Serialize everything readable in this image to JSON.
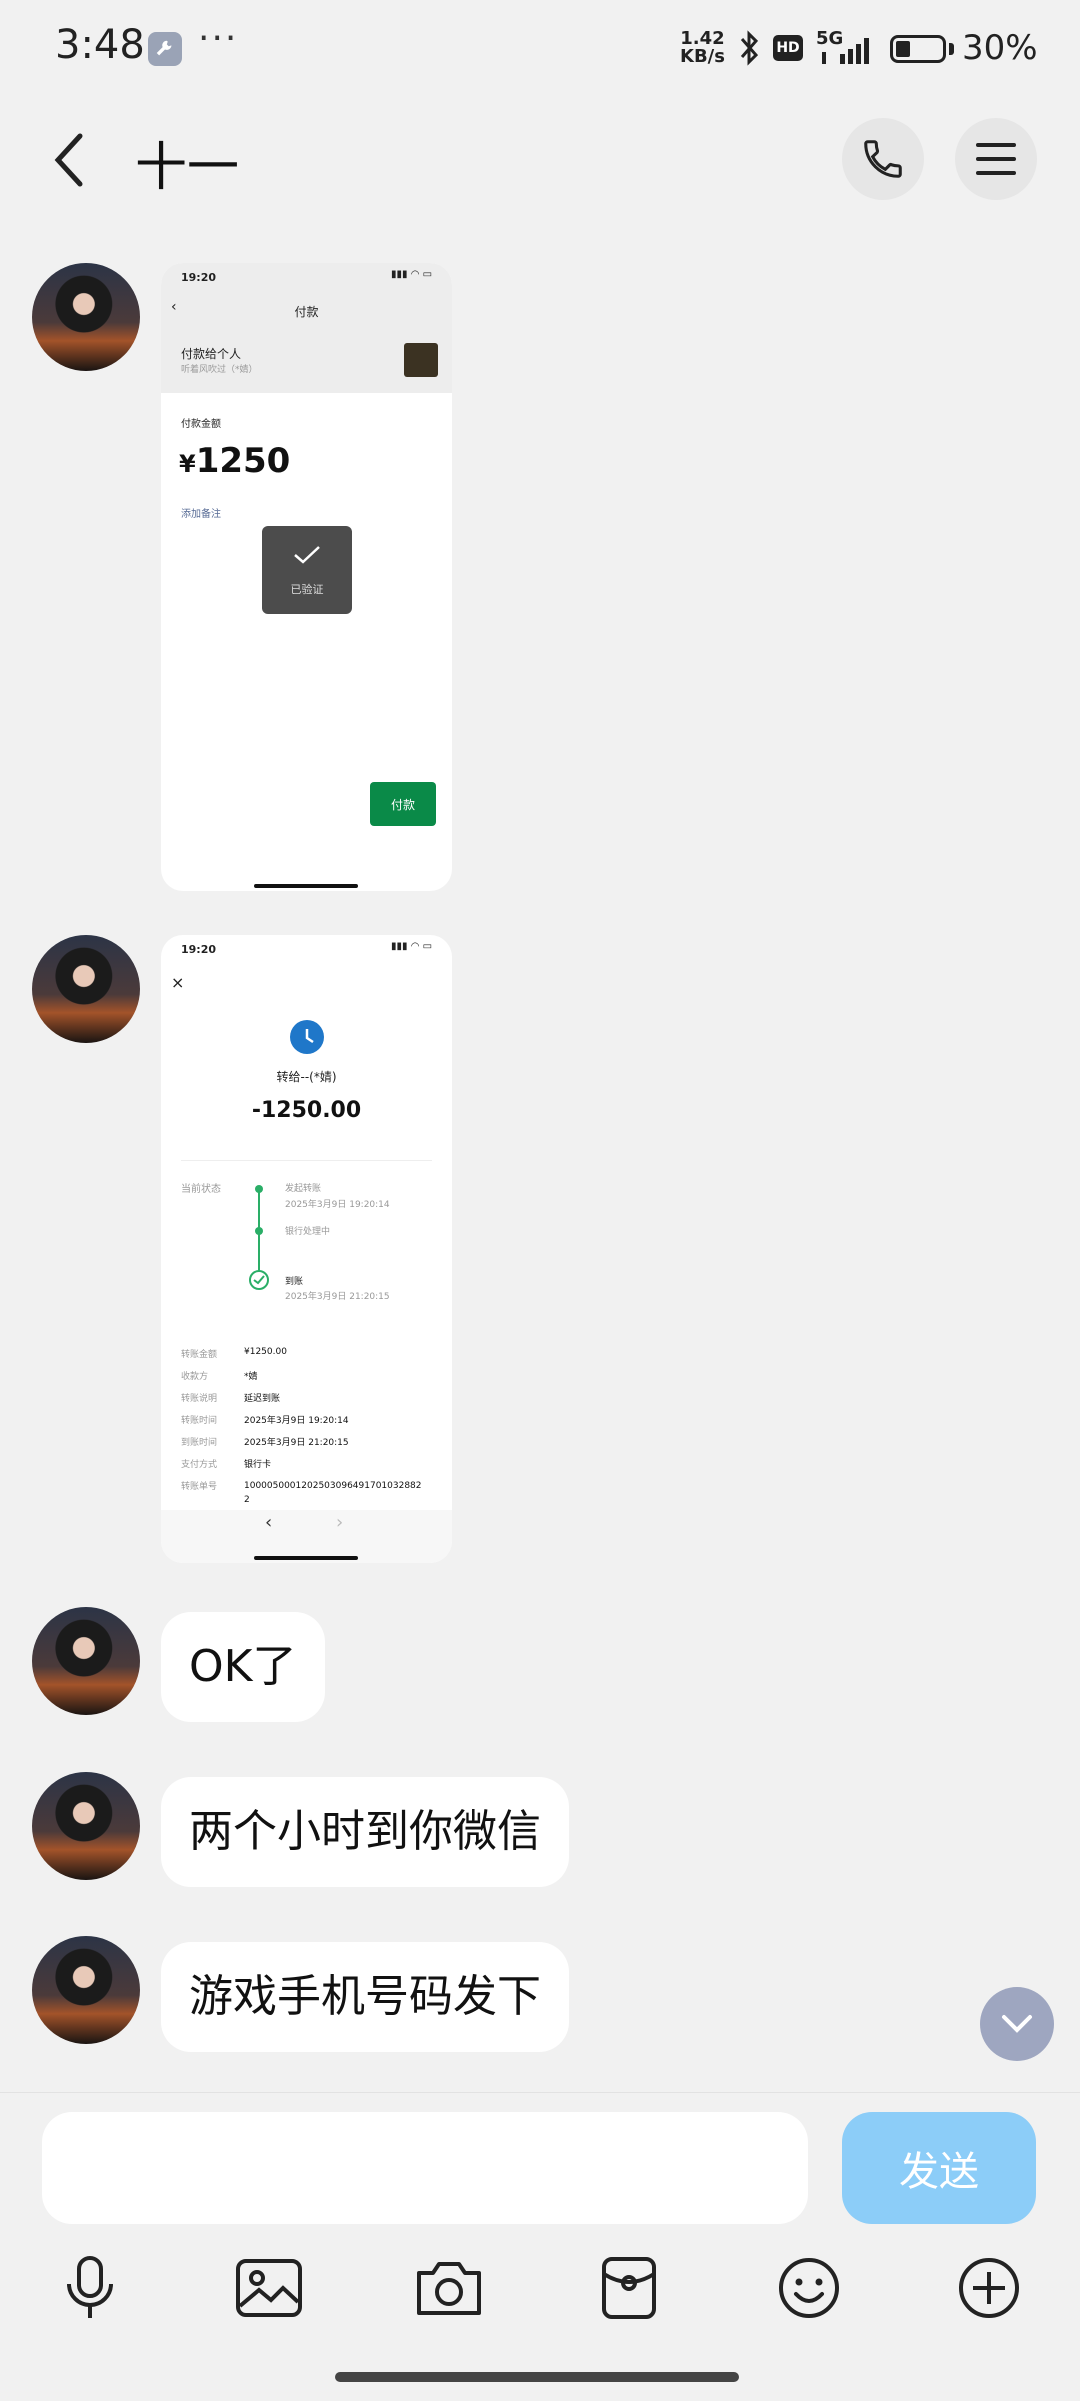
{
  "status_bar": {
    "time": "3:48",
    "net_speed_value": "1.42",
    "net_speed_unit": "KB/s",
    "hd_label": "HD",
    "network_label": "5G",
    "battery_percent": "30%",
    "battery_level": 0.3
  },
  "header": {
    "contact_name": "十一"
  },
  "screenshot1": {
    "time": "19:20",
    "title": "付款",
    "payee_title": "付款给个人",
    "payee_sub": "听着风吹过（*婧）",
    "amount_label": "付款金额",
    "currency": "¥",
    "amount": "1250",
    "add_note": "添加备注",
    "verified_text": "已验证",
    "pay_button": "付款"
  },
  "screenshot2": {
    "time": "19:20",
    "transfer_to": "转给--(*婧)",
    "amount": "-1250.00",
    "status_label": "当前状态",
    "timeline": [
      {
        "title": "发起转账",
        "time": "2025年3月9日 19:20:14"
      },
      {
        "title": "银行处理中",
        "time": ""
      },
      {
        "title": "到账",
        "time": "2025年3月9日 21:20:15"
      }
    ],
    "details": [
      {
        "label": "转账金额",
        "value": "¥1250.00"
      },
      {
        "label": "收款方",
        "value": "*婧"
      },
      {
        "label": "转账说明",
        "value": "延迟到账"
      },
      {
        "label": "转账时间",
        "value": "2025年3月9日 19:20:14"
      },
      {
        "label": "到账时间",
        "value": "2025年3月9日 21:20:15"
      },
      {
        "label": "支付方式",
        "value": "银行卡"
      },
      {
        "label": "转账单号",
        "value": "1000050001202503096491701032882 2"
      }
    ]
  },
  "messages": [
    {
      "text": "OK了"
    },
    {
      "text": "两个小时到你微信"
    },
    {
      "text": "游戏手机号码发下"
    }
  ],
  "composer": {
    "placeholder": "",
    "send_label": "发送"
  }
}
